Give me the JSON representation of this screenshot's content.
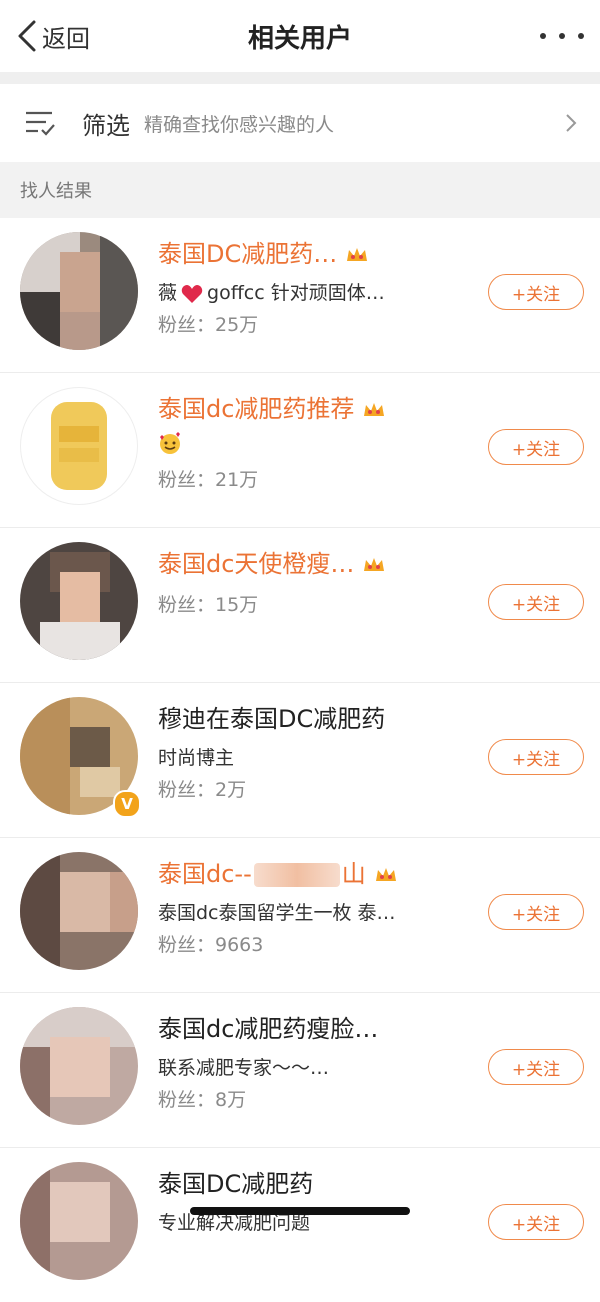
{
  "header": {
    "back_label": "返回",
    "title": "相关用户"
  },
  "filter": {
    "title": "筛选",
    "hint": "精确查找你感兴趣的人"
  },
  "section_title": "找人结果",
  "follow_label": "+关注",
  "results": [
    {
      "name": "泰国DC减肥药…",
      "name_color": "#eb7335",
      "desc_pre": "薇",
      "desc_post": "goffcc 针对顽固体…",
      "fans": "粉丝：25万"
    },
    {
      "name": "泰国dc减肥药推荐",
      "name_color": "#eb7335",
      "fans": "粉丝：21万"
    },
    {
      "name": "泰国dc天使橙瘦…",
      "name_color": "#eb7335",
      "fans": "粉丝：15万"
    },
    {
      "name": "穆迪在泰国DC减肥药",
      "name_color": "#222222",
      "desc": "时尚博主",
      "fans": "粉丝：2万",
      "verified": "V"
    },
    {
      "name_pre": "泰国dc--",
      "name_post": "山",
      "name_color": "#eb7335",
      "desc": "泰国dc泰国留学生一枚 泰…",
      "fans": "粉丝：9663"
    },
    {
      "name": "泰国dc减肥药瘦脸…",
      "name_color": "#222222",
      "desc": "联系减肥专家～～…",
      "fans": "粉丝：8万"
    },
    {
      "name": "泰国DC减肥药",
      "name_color": "#222222",
      "desc": "专业解决减肥问题"
    }
  ]
}
